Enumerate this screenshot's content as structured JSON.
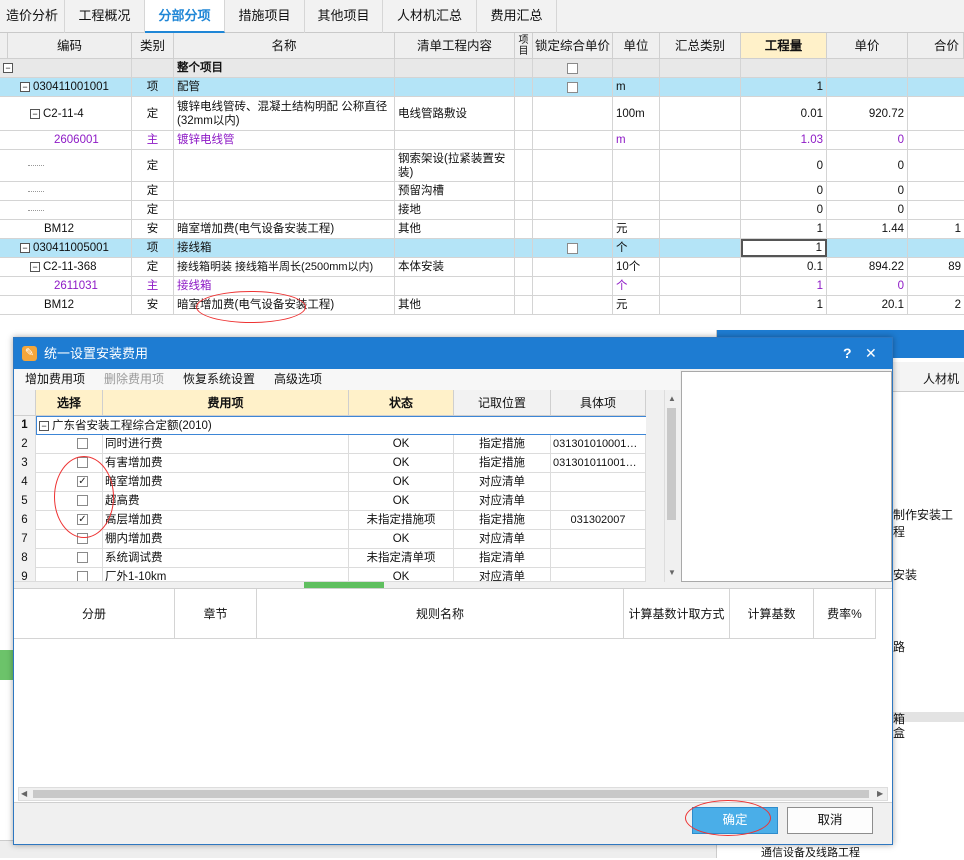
{
  "tabs": [
    "造价分析",
    "工程概况",
    "分部分项",
    "措施项目",
    "其他项目",
    "人材机汇总",
    "费用汇总"
  ],
  "active_tab": "分部分项",
  "main_table": {
    "columns": [
      "编码",
      "类别",
      "名称",
      "清单工程内容",
      "项目",
      "锁定综合单价",
      "单位",
      "汇总类别",
      "工程量",
      "单价",
      "合价"
    ],
    "rows": [
      {
        "code": "",
        "type": "",
        "name": "整个项目",
        "content": "",
        "unit": "",
        "qty": "",
        "price": "",
        "total": ""
      },
      {
        "code": "030411001001",
        "type": "项",
        "name": "配管",
        "content": "",
        "unit": "m",
        "qty": "1",
        "price": "",
        "total": ""
      },
      {
        "code": "C2-11-4",
        "type": "定",
        "name": "镀锌电线管砖、混凝土结构明配 公称直径(32mm以内)",
        "content": "电线管路敷设",
        "unit": "100m",
        "qty": "0.01",
        "price": "920.72",
        "total": ""
      },
      {
        "code": "2606001",
        "type": "主",
        "name": "镀锌电线管",
        "content": "",
        "unit": "m",
        "qty": "1.03",
        "price": "0",
        "total": ""
      },
      {
        "code": "",
        "type": "定",
        "name": "",
        "content": "钢索架设(拉紧装置安装)",
        "unit": "",
        "qty": "0",
        "price": "0",
        "total": ""
      },
      {
        "code": "",
        "type": "定",
        "name": "",
        "content": "预留沟槽",
        "unit": "",
        "qty": "0",
        "price": "0",
        "total": ""
      },
      {
        "code": "",
        "type": "定",
        "name": "",
        "content": "接地",
        "unit": "",
        "qty": "0",
        "price": "0",
        "total": ""
      },
      {
        "code": "BM12",
        "type": "安",
        "name": "暗室增加费(电气设备安装工程)",
        "content": "其他",
        "unit": "元",
        "qty": "1",
        "price": "1.44",
        "total": "1"
      },
      {
        "code": "030411005001",
        "type": "项",
        "name": "接线箱",
        "content": "",
        "unit": "个",
        "qty": "1",
        "price": "",
        "total": ""
      },
      {
        "code": "C2-11-368",
        "type": "定",
        "name": "接线箱明装 接线箱半周长(2500mm以内)",
        "content": "本体安装",
        "unit": "10个",
        "qty": "0.1",
        "price": "894.22",
        "total": "89"
      },
      {
        "code": "2611031",
        "type": "主",
        "name": "接线箱",
        "content": "",
        "unit": "个",
        "qty": "1",
        "price": "0",
        "total": ""
      },
      {
        "code": "BM12",
        "type": "安",
        "name": "暗室增加费(电气设备安装工程)",
        "content": "其他",
        "unit": "元",
        "qty": "1",
        "price": "20.1",
        "total": "2"
      }
    ]
  },
  "dialog": {
    "title": "统一设置安装费用",
    "help": "?",
    "close": "✕",
    "menu": [
      "增加费用项",
      "删除费用项",
      "恢复系统设置",
      "高级选项"
    ],
    "columns": [
      "选择",
      "费用项",
      "状态",
      "记取位置",
      "具体项"
    ],
    "group_label": "广东省安装工程综合定额(2010)",
    "rows": [
      {
        "n": "2",
        "checked": false,
        "item": "同时进行费",
        "status": "OK",
        "pos": "指定措施",
        "detail": "031301010001…"
      },
      {
        "n": "3",
        "checked": false,
        "item": "有害增加费",
        "status": "OK",
        "pos": "指定措施",
        "detail": "031301011001…"
      },
      {
        "n": "4",
        "checked": true,
        "item": "暗室增加费",
        "status": "OK",
        "pos": "对应清单",
        "detail": ""
      },
      {
        "n": "5",
        "checked": false,
        "item": "超高费",
        "status": "OK",
        "pos": "对应清单",
        "detail": ""
      },
      {
        "n": "6",
        "checked": true,
        "item": "高层增加费",
        "status": "未指定措施项",
        "pos": "指定措施",
        "detail": "031302007"
      },
      {
        "n": "7",
        "checked": false,
        "item": "棚内增加费",
        "status": "OK",
        "pos": "对应清单",
        "detail": ""
      },
      {
        "n": "8",
        "checked": false,
        "item": "系统调试费",
        "status": "未指定清单项",
        "pos": "指定清单",
        "detail": ""
      },
      {
        "n": "9",
        "checked": false,
        "item": "厂外1-10km",
        "status": "OK",
        "pos": "对应清单",
        "detail": ""
      }
    ],
    "lower_columns": [
      "分册",
      "章节",
      "规则名称",
      "计算基数计取方式",
      "计算基数",
      "费率%"
    ],
    "ok_label": "确定",
    "cancel_label": "取消"
  },
  "background_right": {
    "tab_label": "人材机",
    "texts": [
      "制作安装工程",
      "安装",
      "路",
      "箱",
      "盒",
      "通信设备及线路工程"
    ]
  }
}
